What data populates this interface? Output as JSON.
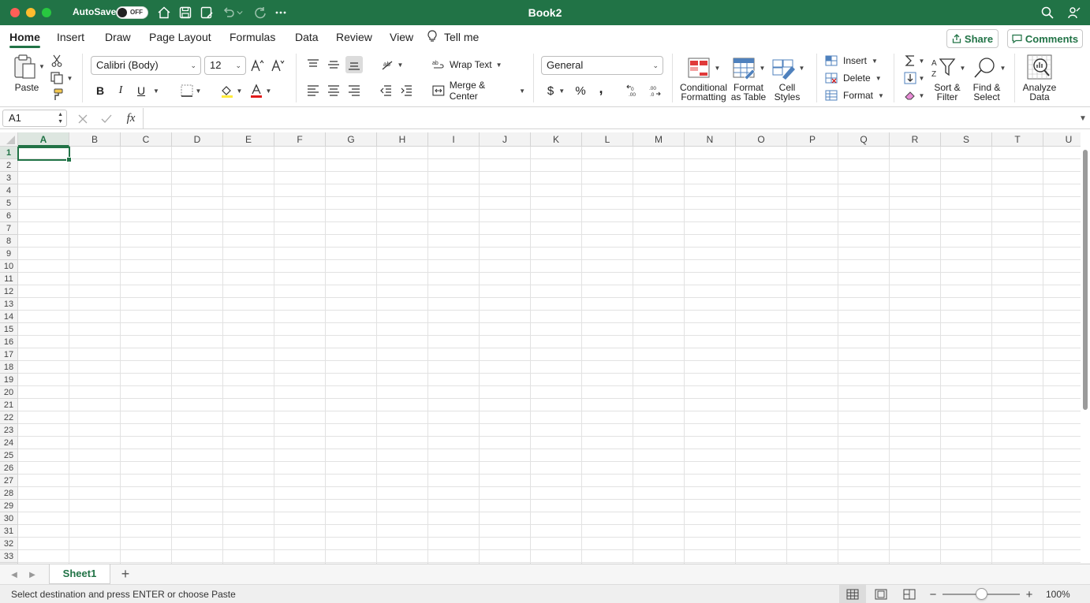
{
  "titlebar": {
    "autosave_label": "AutoSave",
    "autosave_state": "OFF",
    "doc_title": "Book2"
  },
  "tabs": [
    {
      "label": "Home",
      "active": true
    },
    {
      "label": "Insert"
    },
    {
      "label": "Draw"
    },
    {
      "label": "Page Layout"
    },
    {
      "label": "Formulas"
    },
    {
      "label": "Data"
    },
    {
      "label": "Review"
    },
    {
      "label": "View"
    },
    {
      "label": "Tell me"
    }
  ],
  "share_label": "Share",
  "comments_label": "Comments",
  "ribbon": {
    "paste_label": "Paste",
    "font_name": "Calibri (Body)",
    "font_size": "12",
    "bold": "B",
    "italic": "I",
    "underline": "U",
    "wrap_text": "Wrap Text",
    "merge_center": "Merge & Center",
    "number_format": "General",
    "currency": "$",
    "percent": "%",
    "comma": ",",
    "conditional_formatting": [
      "Conditional",
      "Formatting"
    ],
    "format_as_table": [
      "Format",
      "as Table"
    ],
    "cell_styles": [
      "Cell",
      "Styles"
    ],
    "insert": "Insert",
    "delete": "Delete",
    "format": "Format",
    "sort_filter": [
      "Sort &",
      "Filter"
    ],
    "find_select": [
      "Find &",
      "Select"
    ],
    "analyze_data": [
      "Analyze",
      "Data"
    ]
  },
  "formula_bar": {
    "name_box": "A1",
    "fx": "fx",
    "value": ""
  },
  "grid": {
    "columns": [
      "A",
      "B",
      "C",
      "D",
      "E",
      "F",
      "G",
      "H",
      "I",
      "J",
      "K",
      "L",
      "M",
      "N",
      "O",
      "P",
      "Q",
      "R",
      "S",
      "T",
      "U"
    ],
    "rows": [
      "1",
      "2",
      "3",
      "4",
      "5",
      "6",
      "7",
      "8",
      "9",
      "10",
      "11",
      "12",
      "13",
      "14",
      "15",
      "16",
      "17",
      "18",
      "19",
      "20",
      "21",
      "22",
      "23",
      "24",
      "25",
      "26",
      "27",
      "28",
      "29",
      "30",
      "31",
      "32",
      "33"
    ],
    "active_cell": "A1"
  },
  "sheets": [
    {
      "name": "Sheet1",
      "active": true
    }
  ],
  "add_sheet": "+",
  "status": {
    "message": "Select destination and press ENTER or choose Paste",
    "zoom": "100%"
  },
  "colors": {
    "accent": "#217346",
    "titlebar": "#217346"
  }
}
